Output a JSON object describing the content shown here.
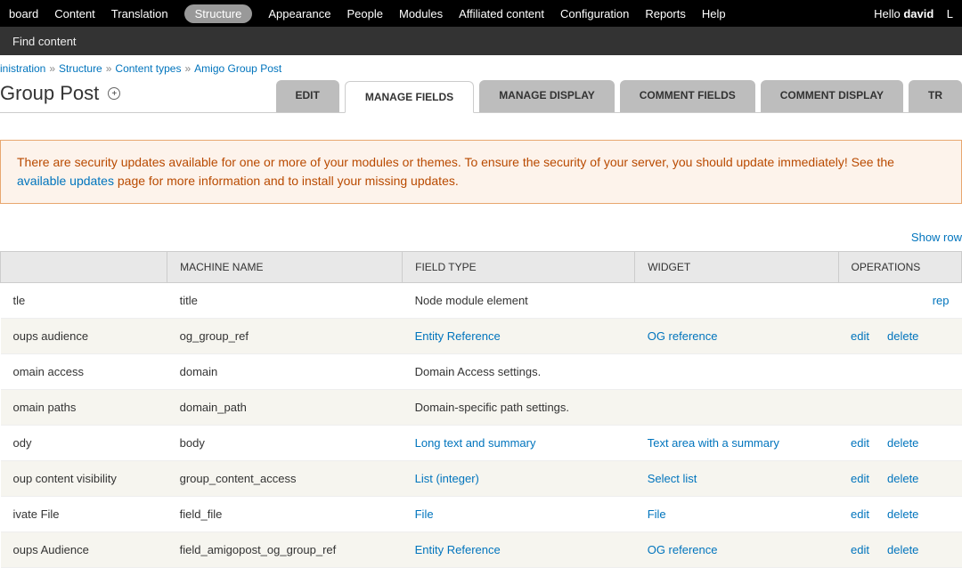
{
  "topbar": {
    "items": [
      "board",
      "Content",
      "Translation",
      "Structure",
      "Appearance",
      "People",
      "Modules",
      "Affiliated content",
      "Configuration",
      "Reports",
      "Help"
    ],
    "active_index": 3,
    "hello": "Hello",
    "user": "david",
    "logout": "L"
  },
  "secondbar": {
    "find": "Find content"
  },
  "breadcrumb": {
    "items": [
      "inistration",
      "Structure",
      "Content types",
      "Amigo Group Post"
    ]
  },
  "page_title": "Group Post",
  "tabs": {
    "items": [
      "EDIT",
      "MANAGE FIELDS",
      "MANAGE DISPLAY",
      "COMMENT FIELDS",
      "COMMENT DISPLAY",
      "TR"
    ],
    "active_index": 1
  },
  "message": {
    "text1": "There are security updates available for one or more of your modules or themes. To ensure the security of your server, you should update immediately! See the ",
    "link": "available updates",
    "text2": " page for more information and to install your missing updates."
  },
  "show_row": "Show row",
  "columns": [
    "",
    "MACHINE NAME",
    "FIELD TYPE",
    "WIDGET",
    "OPERATIONS"
  ],
  "rows": [
    {
      "label": "tle",
      "machine": "title",
      "field_type": "Node module element",
      "field_link": false,
      "widget": "",
      "widget_link": false,
      "ops": [],
      "op_right": "rep"
    },
    {
      "label": "oups audience",
      "machine": "og_group_ref",
      "field_type": "Entity Reference",
      "field_link": true,
      "widget": "OG reference",
      "widget_link": true,
      "ops": [
        "edit",
        "delete"
      ],
      "op_right": ""
    },
    {
      "label": "omain access",
      "machine": "domain",
      "field_type": "Domain Access settings.",
      "field_link": false,
      "widget": "",
      "widget_link": false,
      "ops": [],
      "op_right": ""
    },
    {
      "label": "omain paths",
      "machine": "domain_path",
      "field_type": "Domain-specific path settings.",
      "field_link": false,
      "widget": "",
      "widget_link": false,
      "ops": [],
      "op_right": ""
    },
    {
      "label": "ody",
      "machine": "body",
      "field_type": "Long text and summary",
      "field_link": true,
      "widget": "Text area with a summary",
      "widget_link": true,
      "ops": [
        "edit",
        "delete"
      ],
      "op_right": ""
    },
    {
      "label": "oup content visibility",
      "machine": "group_content_access",
      "field_type": "List (integer)",
      "field_link": true,
      "widget": "Select list",
      "widget_link": true,
      "ops": [
        "edit",
        "delete"
      ],
      "op_right": ""
    },
    {
      "label": "ivate File",
      "machine": "field_file",
      "field_type": "File",
      "field_link": true,
      "widget": "File",
      "widget_link": true,
      "ops": [
        "edit",
        "delete"
      ],
      "op_right": ""
    },
    {
      "label": "oups Audience",
      "machine": "field_amigopost_og_group_ref",
      "field_type": "Entity Reference",
      "field_link": true,
      "widget": "OG reference",
      "widget_link": true,
      "ops": [
        "edit",
        "delete"
      ],
      "op_right": ""
    }
  ]
}
